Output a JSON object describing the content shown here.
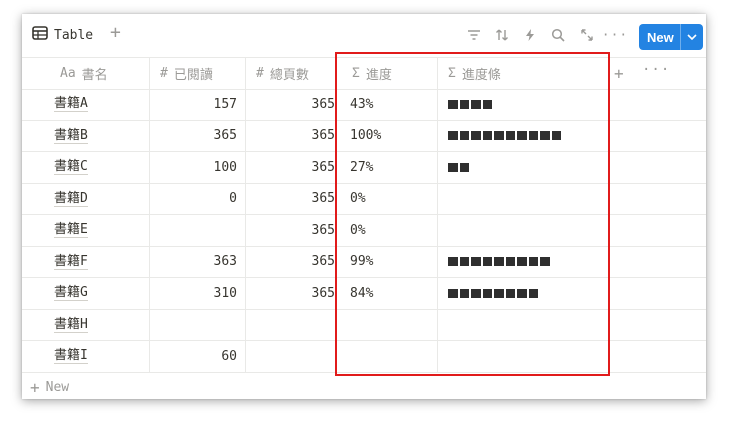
{
  "toolbar": {
    "view_label": "Table",
    "add_view": "+",
    "more": "···",
    "new_label": "New"
  },
  "columns": [
    {
      "icon": "Aa",
      "label": "書名"
    },
    {
      "icon": "#",
      "label": "已閱讀"
    },
    {
      "icon": "#",
      "label": "總頁數"
    },
    {
      "icon": "Σ",
      "label": "進度"
    },
    {
      "icon": "Σ",
      "label": "進度條"
    }
  ],
  "header_add": "+",
  "header_more": "···",
  "rows": [
    {
      "name": "書籍A",
      "read": "157",
      "total": "365",
      "progress": "43%",
      "bar": 4
    },
    {
      "name": "書籍B",
      "read": "365",
      "total": "365",
      "progress": "100%",
      "bar": 10
    },
    {
      "name": "書籍C",
      "read": "100",
      "total": "365",
      "progress": "27%",
      "bar": 2
    },
    {
      "name": "書籍D",
      "read": "0",
      "total": "365",
      "progress": "0%",
      "bar": 0
    },
    {
      "name": "書籍E",
      "read": "",
      "total": "365",
      "progress": "0%",
      "bar": 0
    },
    {
      "name": "書籍F",
      "read": "363",
      "total": "365",
      "progress": "99%",
      "bar": 9
    },
    {
      "name": "書籍G",
      "read": "310",
      "total": "365",
      "progress": "84%",
      "bar": 8
    },
    {
      "name": "書籍H",
      "read": "",
      "total": "",
      "progress": "",
      "bar": 0
    },
    {
      "name": "書籍I",
      "read": "60",
      "total": "",
      "progress": "",
      "bar": 0
    }
  ],
  "new_row_label": "New",
  "colors": {
    "accent": "#2383e2",
    "highlight": "#e11b1b",
    "bar": "#2f2f2f"
  }
}
